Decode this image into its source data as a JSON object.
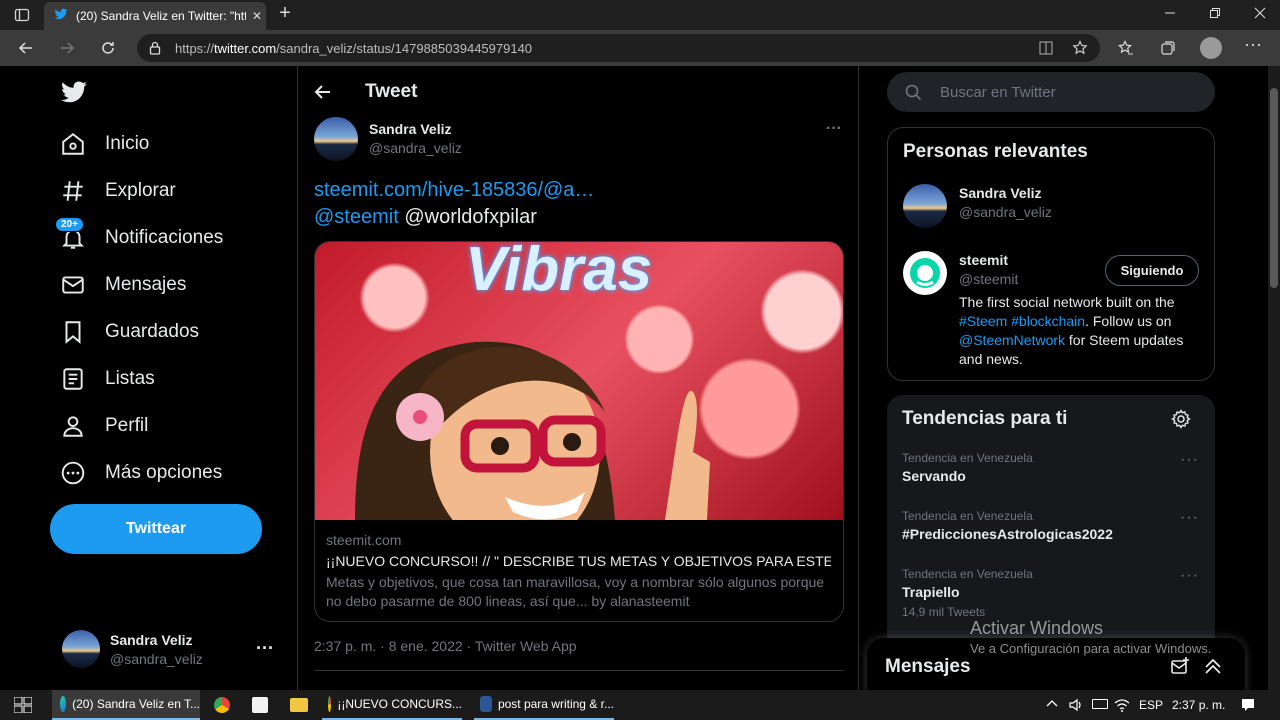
{
  "browser": {
    "tab_title": "(20) Sandra Veliz en Twitter: \"htt",
    "url_scheme": "https://",
    "url_host": "twitter.com",
    "url_path": "/sandra_veliz/status/1479885039445979140",
    "tab_close": "✕",
    "new_tab": "+"
  },
  "nav": {
    "items": [
      {
        "label": "Inicio",
        "icon": "home-icon"
      },
      {
        "label": "Explorar",
        "icon": "hashtag-icon"
      },
      {
        "label": "Notificaciones",
        "icon": "bell-icon",
        "badge": "20+"
      },
      {
        "label": "Mensajes",
        "icon": "envelope-icon"
      },
      {
        "label": "Guardados",
        "icon": "bookmark-icon"
      },
      {
        "label": "Listas",
        "icon": "list-icon"
      },
      {
        "label": "Perfil",
        "icon": "person-icon"
      },
      {
        "label": "Más opciones",
        "icon": "more-circle-icon"
      }
    ],
    "tweet_button": "Twittear",
    "account": {
      "name": "Sandra Veliz",
      "handle": "@sandra_veliz",
      "more": "···"
    }
  },
  "tweet": {
    "header": "Tweet",
    "author_name": "Sandra Veliz",
    "author_handle": "@sandra_veliz",
    "more": "···",
    "link": "steemit.com/hive-185836/@a…",
    "mention1": "@steemit",
    "mention2": "@worldofxpilar",
    "card": {
      "image_text": "Vibras",
      "domain": "steemit.com",
      "title": "¡¡NUEVO CONCURSO!! // \" DESCRIBE TUS METAS Y OBJETIVOS PARA ESTE ...",
      "desc": "Metas y objetivos, que cosa tan maravillosa, voy a nombrar sólo algunos porque no debo pasarme de 800 lineas, así que... by alanasteemit"
    },
    "timestamp": "2:37 p. m. · 8 ene. 2022 · Twitter Web App"
  },
  "sidebar": {
    "search_placeholder": "Buscar en Twitter",
    "relevant": {
      "title": "Personas relevantes",
      "people": [
        {
          "name": "Sandra Veliz",
          "handle": "@sandra_veliz"
        },
        {
          "name": "steemit",
          "handle": "@steemit",
          "button": "Siguiendo",
          "bio_1": "The first social network built on the",
          "bio_tag1": "#Steem",
          "bio_tag2": "#blockchain",
          "bio_2": ". Follow us on",
          "bio_mention": "@SteemNetwork",
          "bio_3": " for Steem updates",
          "bio_4": "and news."
        }
      ]
    },
    "trends": {
      "title": "Tendencias para ti",
      "items": [
        {
          "context": "Tendencia en Venezuela",
          "name": "Servando",
          "count": ""
        },
        {
          "context": "Tendencia en Venezuela",
          "name": "#PrediccionesAstrologicas2022",
          "count": ""
        },
        {
          "context": "Tendencia en Venezuela",
          "name": "Trapiello",
          "count": "14,9 mil Tweets"
        }
      ],
      "more": "···"
    },
    "messages": "Mensajes"
  },
  "watermark": {
    "line1": "Activar Windows",
    "line2": "Ve a Configuración para activar Windows."
  },
  "taskbar": {
    "items": [
      {
        "label": "(20) Sandra Veliz en T..."
      },
      {
        "label": "¡¡NUEVO CONCURS..."
      },
      {
        "label": "post para writing & r..."
      }
    ],
    "lang": "ESP",
    "time": "2:37 p. m."
  },
  "colors": {
    "accent": "#1d9bf0",
    "background": "#000000",
    "border": "#2f3336"
  }
}
